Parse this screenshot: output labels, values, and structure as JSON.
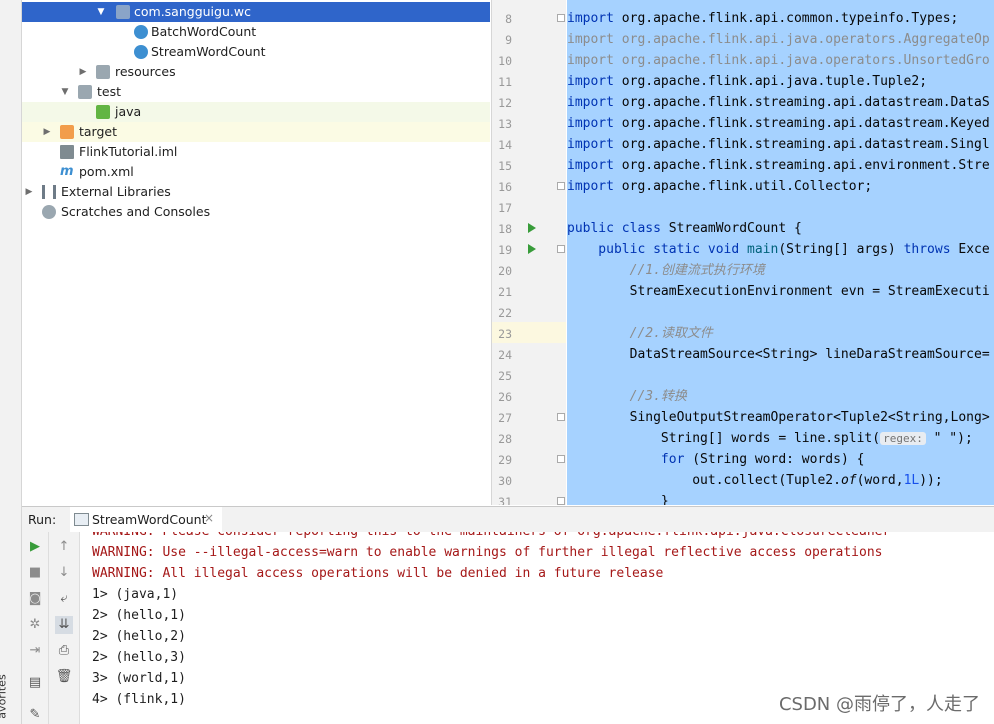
{
  "sidebar": {
    "favorites_label": "avorites"
  },
  "tree": {
    "rows": [
      {
        "label": "com.sangguigu.wc",
        "arrow": "▼",
        "icon": "package-folder-icon"
      },
      {
        "label": "BatchWordCount",
        "arrow": "",
        "icon": "java-class-icon"
      },
      {
        "label": "StreamWordCount",
        "arrow": "",
        "icon": "java-class-icon"
      },
      {
        "label": "resources",
        "arrow": "▶",
        "icon": "resources-folder-icon"
      },
      {
        "label": "test",
        "arrow": "▼",
        "icon": "folder-icon"
      },
      {
        "label": "java",
        "arrow": "",
        "icon": "test-folder-icon"
      },
      {
        "label": "target",
        "arrow": "▶",
        "icon": "excluded-folder-icon"
      },
      {
        "label": "FlinkTutorial.iml",
        "arrow": "",
        "icon": "iml-file-icon"
      },
      {
        "label": "pom.xml",
        "arrow": "",
        "icon": "maven-file-icon"
      },
      {
        "label": "External Libraries",
        "arrow": "▶",
        "icon": "libraries-icon"
      },
      {
        "label": "Scratches and Consoles",
        "arrow": "",
        "icon": "scratches-icon"
      }
    ]
  },
  "editor": {
    "line_numbers": [
      "8",
      "9",
      "10",
      "11",
      "12",
      "13",
      "14",
      "15",
      "16",
      "17",
      "18",
      "19",
      "20",
      "21",
      "22",
      "23",
      "24",
      "25",
      "26",
      "27",
      "28",
      "29",
      "30",
      "31"
    ],
    "code": {
      "l8": "org.apache.flink.api.common.typeinfo.Types;",
      "l9": "org.apache.flink.api.java.operators.AggregateOp",
      "l10": "org.apache.flink.api.java.operators.UnsortedGro",
      "l11": "org.apache.flink.api.java.tuple.Tuple2;",
      "l12": "org.apache.flink.streaming.api.datastream.DataS",
      "l13": "org.apache.flink.streaming.api.datastream.Keyed",
      "l14": "org.apache.flink.streaming.api.datastream.Singl",
      "l15": "org.apache.flink.streaming.api.environment.Stre",
      "l16": "org.apache.flink.util.Collector;",
      "import_kw": "import",
      "l18_a": "public class",
      "l18_b": " StreamWordCount {",
      "l19_a": "    public static",
      "l19_b": " void ",
      "l19_c": "main",
      "l19_d": "(String[] args) ",
      "l19_e": "throws",
      "l19_f": " Exce",
      "l20": "        //1.创建流式执行环境",
      "l21": "        StreamExecutionEnvironment evn = StreamExecuti",
      "l23": "        //2.读取文件",
      "l24": "        DataStreamSource<String> lineDaraStreamSource=",
      "l26": "        //3.转换",
      "l27": "        SingleOutputStreamOperator<Tuple2<String,Long>",
      "l28_a": "            String[] words = line.split(",
      "l28_hint": "regex:",
      "l28_b": " \" \");",
      "l29_a": "            for",
      "l29_b": " (String word: words) {",
      "l30_a": "                out.collect(Tuple2.",
      "l30_b": "of",
      "l30_c": "(word,",
      "l30_d": "1L",
      "l30_e": "));",
      "l31": "            }"
    }
  },
  "run": {
    "label": "Run:",
    "tab_label": "StreamWordCount",
    "close": "×",
    "output": [
      {
        "text": "WARNING: Please consider reporting this to the maintainers of org.apache.flink.api.java.ClosureCleaner",
        "type": "warn"
      },
      {
        "text": "WARNING: Use --illegal-access=warn to enable warnings of further illegal reflective access operations",
        "type": "warn"
      },
      {
        "text": "WARNING: All illegal access operations will be denied in a future release",
        "type": "warn"
      },
      {
        "text": "1> (java,1)",
        "type": "norm"
      },
      {
        "text": "2> (hello,1)",
        "type": "norm"
      },
      {
        "text": "2> (hello,2)",
        "type": "norm"
      },
      {
        "text": "2> (hello,3)",
        "type": "norm"
      },
      {
        "text": "3> (world,1)",
        "type": "norm"
      },
      {
        "text": "4> (flink,1)",
        "type": "norm"
      }
    ]
  },
  "watermark": "CSDN @雨停了，人走了",
  "colors": {
    "selection": "#2f65ca",
    "code_selection": "#a6d2ff",
    "warning": "#a51818",
    "run_green": "#389c3a"
  }
}
